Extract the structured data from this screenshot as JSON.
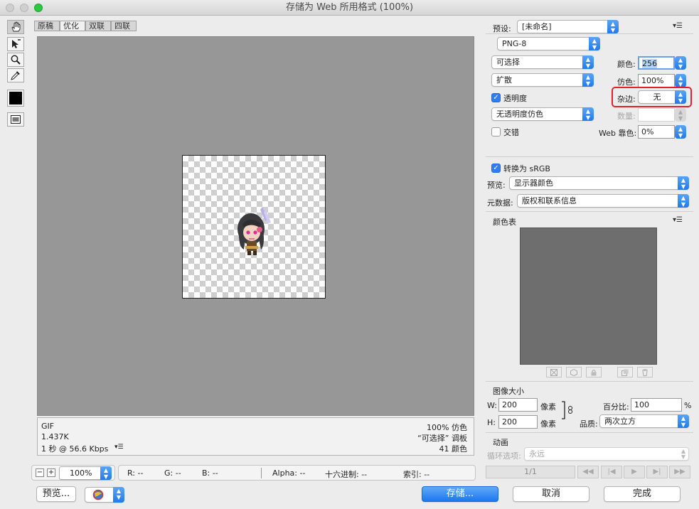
{
  "window": {
    "title": "存储为 Web 所用格式 (100%)"
  },
  "tabs": [
    {
      "label": "原稿",
      "active": false
    },
    {
      "label": "优化",
      "active": true
    },
    {
      "label": "双联",
      "active": false
    },
    {
      "label": "四联",
      "active": false
    }
  ],
  "tools": [
    {
      "name": "hand-tool-icon",
      "glyph": "✋"
    },
    {
      "name": "slice-select-icon",
      "glyph": "↗"
    },
    {
      "name": "zoom-tool-icon",
      "glyph": "⚲"
    },
    {
      "name": "eyedropper-icon",
      "glyph": "✎"
    }
  ],
  "info_left": {
    "format": "GIF",
    "size": "1.437K",
    "speed": "1 秒 @ 56.6 Kbps"
  },
  "info_right": {
    "dither": "100% 仿色",
    "palette": "“可选择” 调板",
    "colors": "41 颜色"
  },
  "statusbar": {
    "zoom": "100%",
    "r": "R: --",
    "g": "G: --",
    "b": "B: --",
    "alpha": "Alpha: --",
    "hex": "十六进制: --",
    "index": "索引: --"
  },
  "settings": {
    "preset_label": "预设:",
    "preset_value": "[未命名]",
    "format_value": "PNG-8",
    "reduction_value": "可选择",
    "colors_label": "颜色:",
    "colors_value": "256",
    "dither_algo": "扩散",
    "dither_label": "仿色:",
    "dither_value": "100%",
    "transparency_label": "透明度",
    "matte_label": "杂边:",
    "matte_value": "无",
    "trans_dither_value": "无透明度仿色",
    "amount_label": "数量:",
    "interlaced_label": "交错",
    "websnap_label": "Web 靠色:",
    "websnap_value": "0%",
    "srgb_label": "转换为 sRGB",
    "preview_label": "预览:",
    "preview_value": "显示器颜色",
    "metadata_label": "元数据:",
    "metadata_value": "版权和联系信息",
    "colortable_label": "颜色表"
  },
  "image_size": {
    "label": "图像大小",
    "w_label": "W:",
    "w_value": "200",
    "w_unit": "像素",
    "h_label": "H:",
    "h_value": "200",
    "h_unit": "像素",
    "percent_label": "百分比:",
    "percent_value": "100",
    "percent_unit": "%",
    "quality_label": "品质:",
    "quality_value": "两次立方"
  },
  "animation": {
    "label": "动画",
    "loop_label": "循环选项:",
    "loop_value": "永远",
    "frame_counter": "1/1"
  },
  "buttons": {
    "preview": "预览...",
    "save": "存储...",
    "cancel": "取消",
    "done": "完成"
  }
}
